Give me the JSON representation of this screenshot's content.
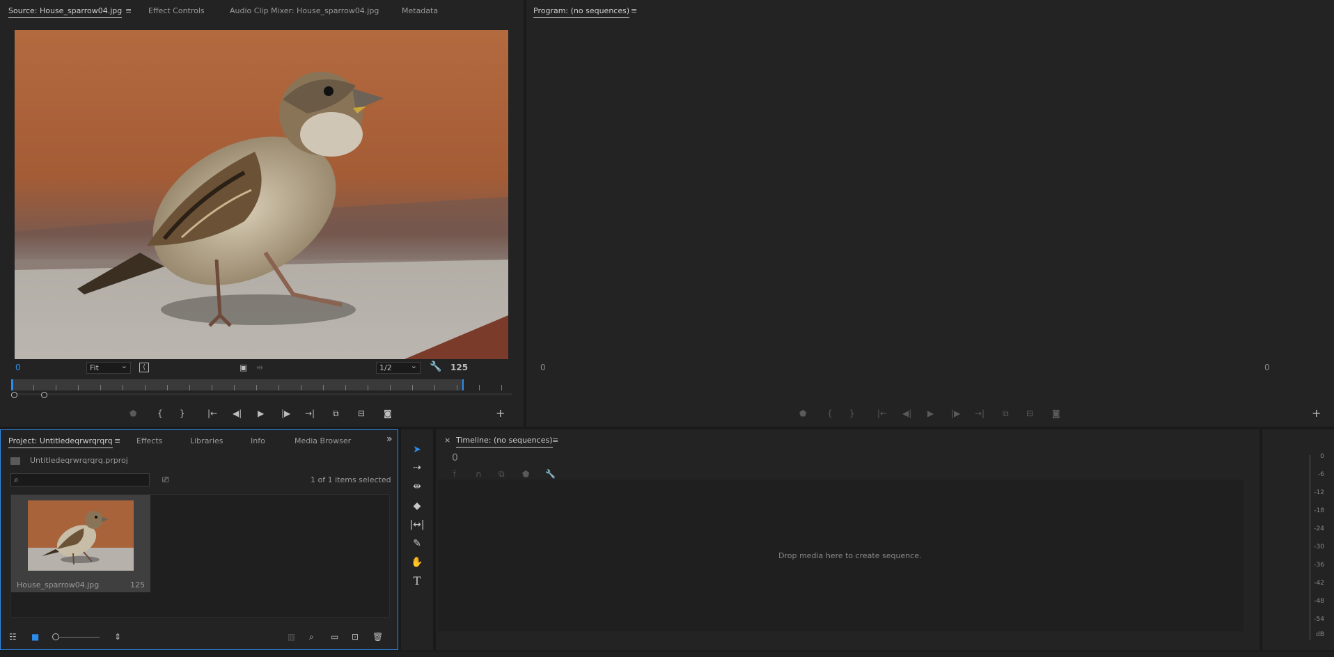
{
  "source": {
    "tabs": [
      "Source: House_sparrow04.jpg",
      "Effect Controls",
      "Audio Clip Mixer: House_sparrow04.jpg",
      "Metadata"
    ],
    "timecode_in": "0",
    "timecode_out": "125",
    "zoom": "Fit",
    "resolution": "1/2"
  },
  "program": {
    "title": "Program: (no sequences)",
    "timecode_in": "0",
    "timecode_out": "0"
  },
  "project": {
    "tabs": [
      "Project: Untitledeqrwrqrqrq",
      "Effects",
      "Libraries",
      "Info",
      "Media Browser"
    ],
    "file": "Untitledeqrwrqrqrq.prproj",
    "selection_count": "1 of 1 items selected",
    "search_placeholder": "",
    "items": [
      {
        "name": "House_sparrow04.jpg",
        "duration": "125"
      }
    ]
  },
  "timeline": {
    "title": "Timeline: (no sequences)",
    "close": "×",
    "timecode": "0",
    "drop_hint": "Drop media here to create sequence."
  },
  "meter": {
    "ticks": [
      "0",
      "-6",
      "-12",
      "-18",
      "-24",
      "-30",
      "-36",
      "-42",
      "-48",
      "-54",
      "dB"
    ]
  },
  "glyphs": {
    "menu": "≡",
    "plus": "+",
    "chevrons": "»",
    "chevron_down": "⌄",
    "brace_open": "{",
    "brace_close": "}",
    "play": "▶",
    "text_tool": "T"
  }
}
